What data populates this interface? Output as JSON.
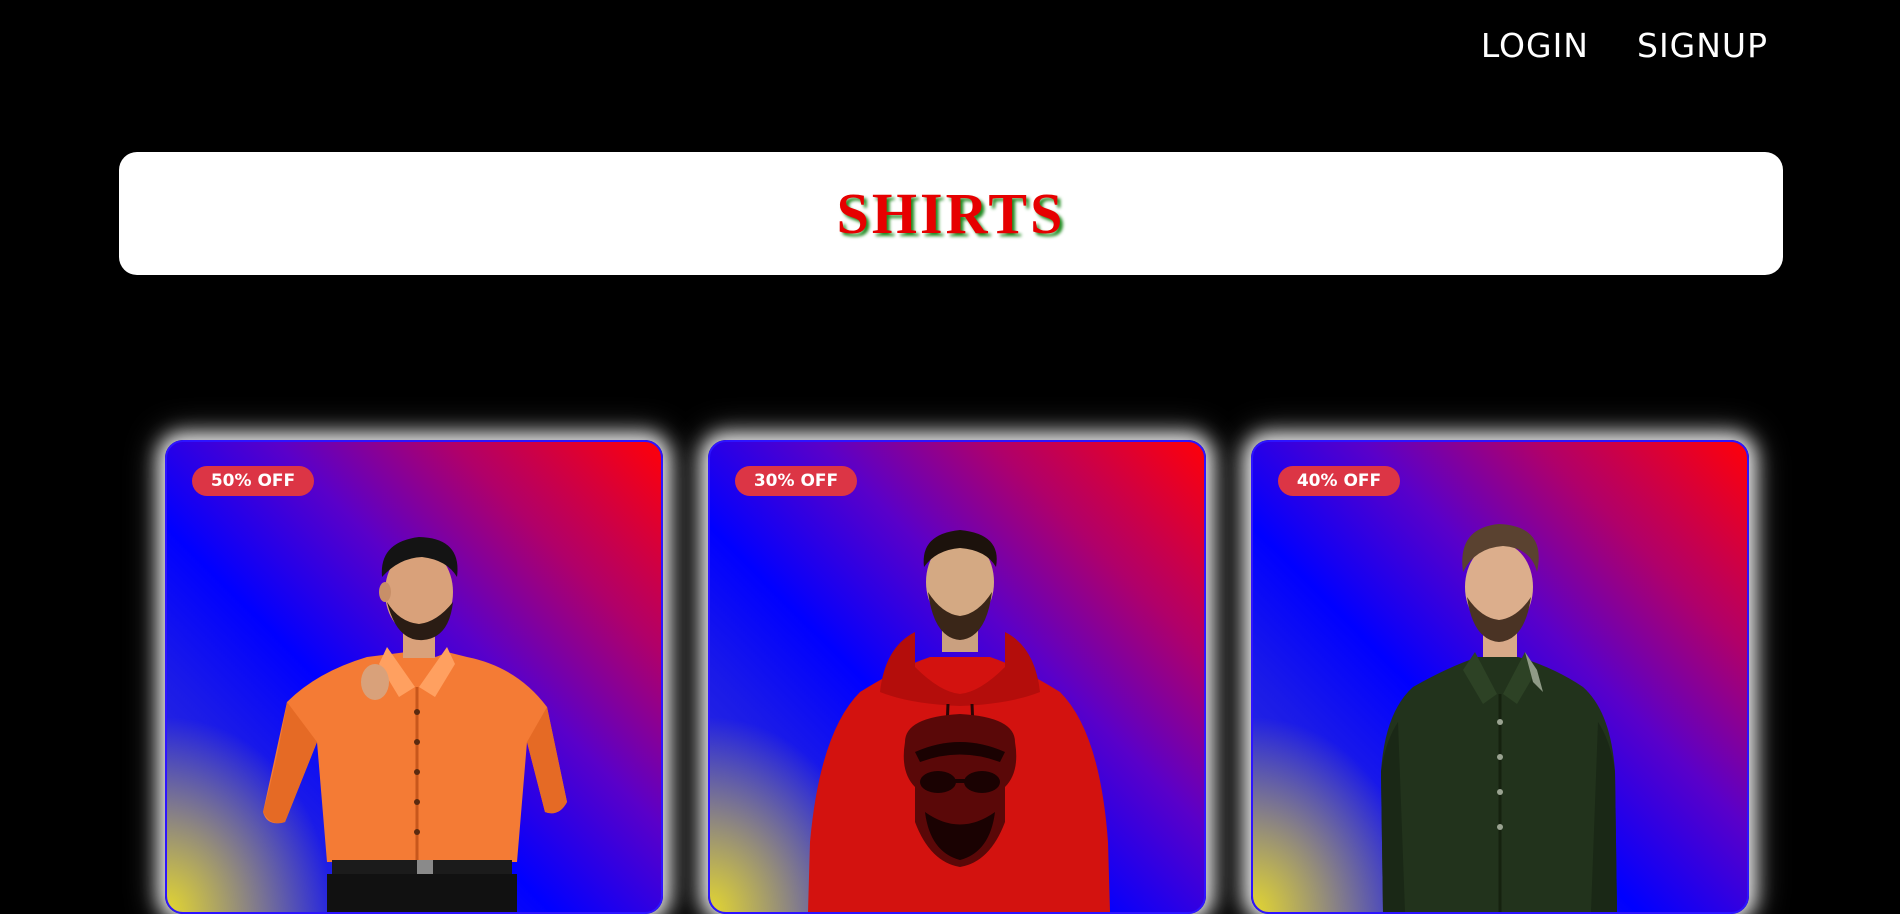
{
  "nav": {
    "login_label": "LOGIN",
    "signup_label": "SIGNUP"
  },
  "header": {
    "title": "SHIRTS"
  },
  "products": [
    {
      "discount": "50% OFF",
      "image": "man-orange-shirt",
      "shirt_color": "#f47b35"
    },
    {
      "discount": "30% OFF",
      "image": "man-red-hoodie-skull-print",
      "shirt_color": "#d3120f"
    },
    {
      "discount": "40% OFF",
      "image": "man-dark-green-shirt",
      "shirt_color": "#22331c"
    }
  ],
  "colors": {
    "background": "#000000",
    "title_red": "#e60000",
    "title_shadow_green": "#1f8a1f",
    "badge_red": "#dc3545",
    "card_gradient_red": "#ff0008",
    "card_gradient_blue": "#0000ff"
  }
}
